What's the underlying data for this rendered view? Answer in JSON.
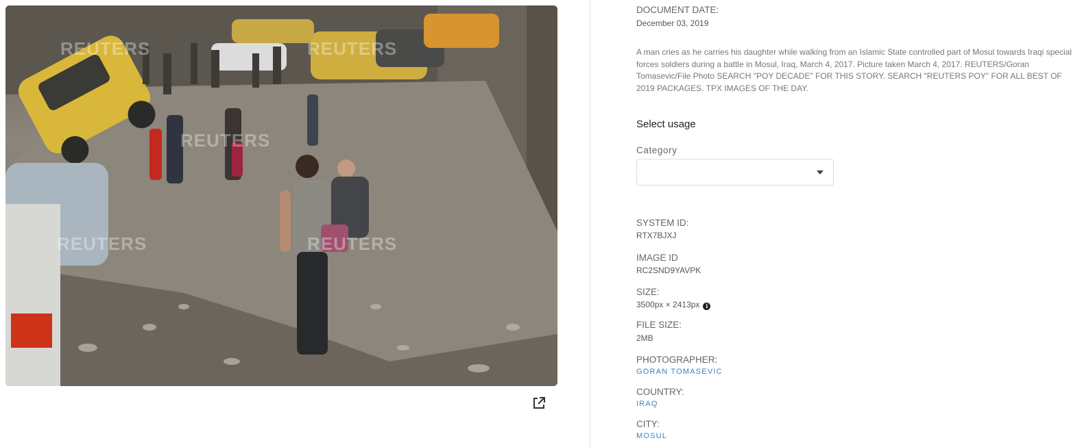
{
  "photo": {
    "watermarks": [
      "REUTERS",
      "REUTERS",
      "REUTERS",
      "REUTERS",
      "REUTERS"
    ],
    "external_link_icon": "external-link-icon"
  },
  "meta": {
    "document_date_label": "DOCUMENT DATE:",
    "document_date_value": "December 03, 2019",
    "caption": "A man cries as he carries his daughter while walking from an Islamic State controlled part of Mosul towards Iraqi special forces soldiers during a battle in Mosul, Iraq, March 4, 2017. Picture taken March 4, 2017. REUTERS/Goran Tomasevic/File Photo SEARCH \"POY DECADE\" FOR THIS STORY. SEARCH \"REUTERS POY\" FOR ALL BEST OF 2019 PACKAGES. TPX IMAGES OF THE DAY.",
    "select_usage_label": "Select usage",
    "category_label": "Category",
    "category_value": "",
    "system_id_label": "SYSTEM ID:",
    "system_id_value": "RTX7BJXJ",
    "image_id_label": "IMAGE ID",
    "image_id_value": "RC2SND9YAVPK",
    "size_label": "SIZE:",
    "size_value": "3500px × 2413px",
    "file_size_label": "FILE SIZE:",
    "file_size_value": "2MB",
    "photographer_label": "PHOTOGRAPHER:",
    "photographer_value": "GORAN TOMASEVIC",
    "country_label": "COUNTRY:",
    "country_value": "IRAQ",
    "city_label": "CITY:",
    "city_value": "MOSUL"
  }
}
